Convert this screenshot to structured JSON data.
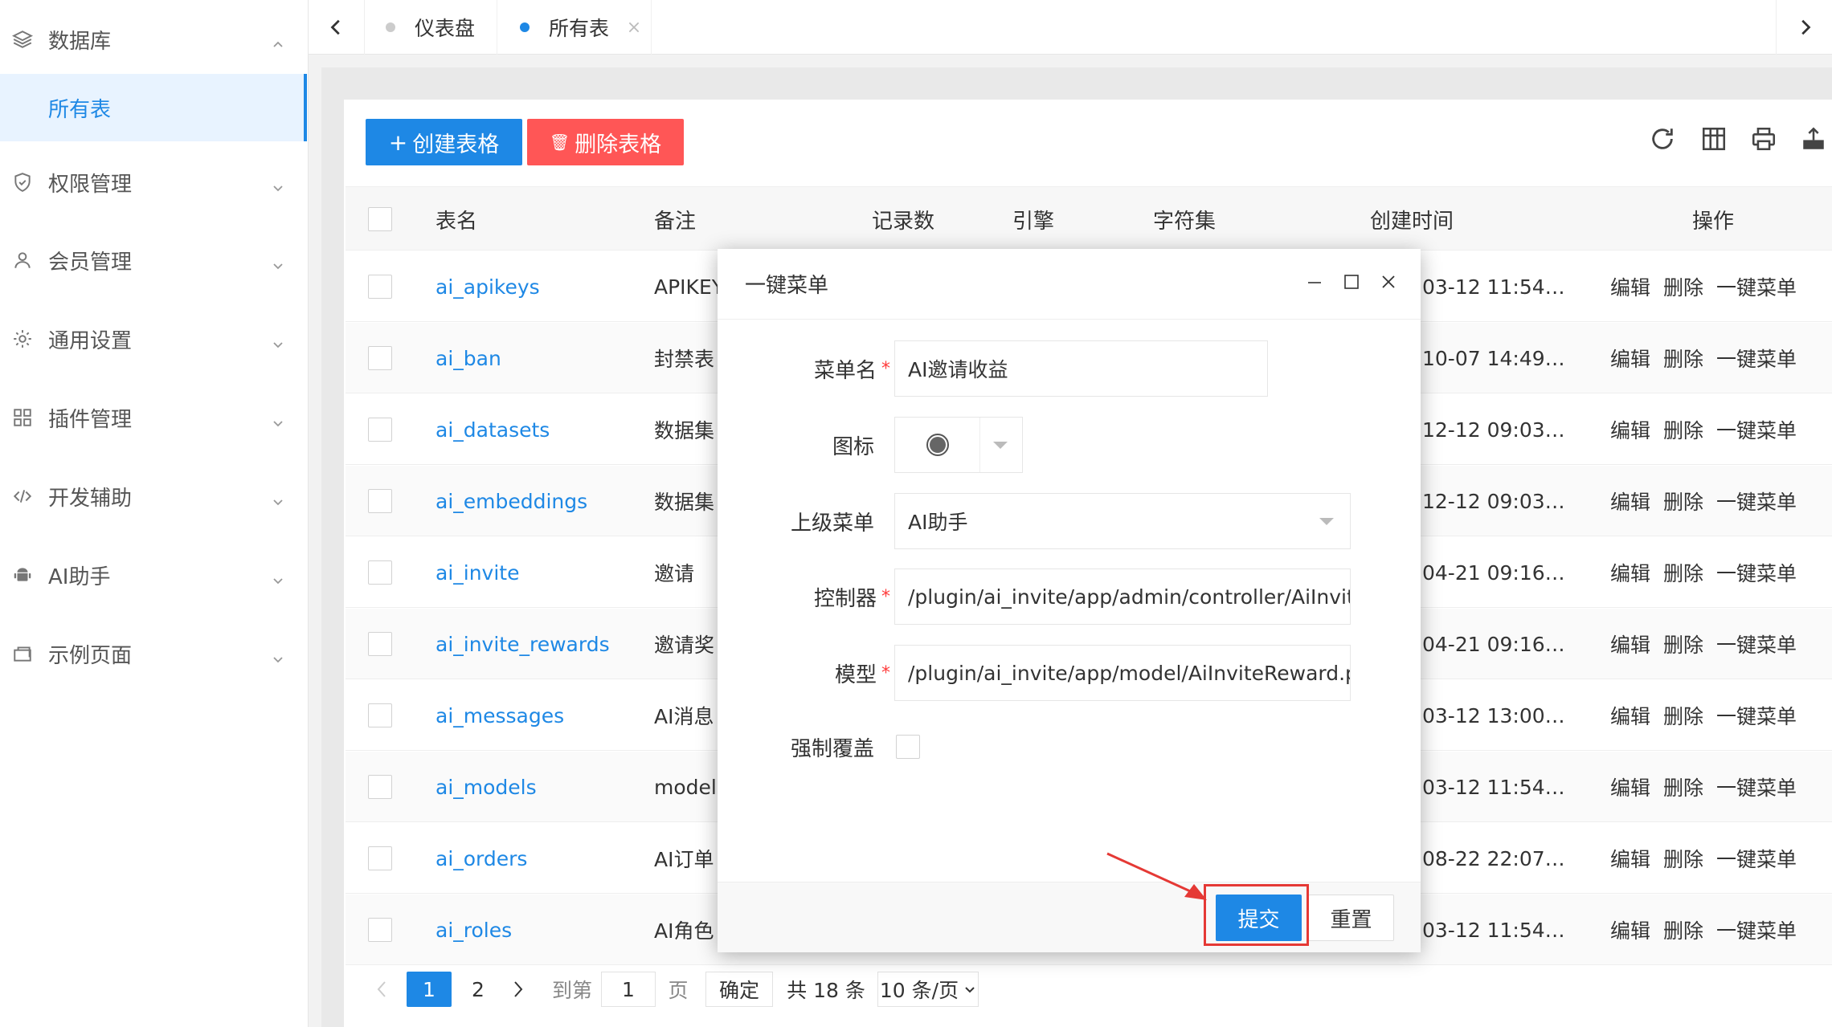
{
  "sidebar": {
    "groups": [
      {
        "label": "数据库",
        "icon": "layers-icon",
        "expanded": true
      },
      {
        "label": "权限管理",
        "icon": "shield-icon"
      },
      {
        "label": "会员管理",
        "icon": "user-icon"
      },
      {
        "label": "通用设置",
        "icon": "gear-icon"
      },
      {
        "label": "插件管理",
        "icon": "grid-icon"
      },
      {
        "label": "开发辅助",
        "icon": "code-icon"
      },
      {
        "label": "AI助手",
        "icon": "android-icon"
      },
      {
        "label": "示例页面",
        "icon": "template-icon"
      }
    ],
    "active_sub": "所有表"
  },
  "tabs": [
    {
      "label": "仪表盘",
      "active": false
    },
    {
      "label": "所有表",
      "active": true
    }
  ],
  "toolbar": {
    "create_label": "创建表格",
    "delete_label": "删除表格"
  },
  "table": {
    "headers": [
      "表名",
      "备注",
      "记录数",
      "引擎",
      "字符集",
      "创建时间",
      "操作"
    ],
    "rows": [
      {
        "name": "ai_apikeys",
        "remark": "APIKEY",
        "created": "03-12 11:54…"
      },
      {
        "name": "ai_ban",
        "remark": "封禁表",
        "created": "10-07 14:49…"
      },
      {
        "name": "ai_datasets",
        "remark": "数据集",
        "created": "12-12 09:03…"
      },
      {
        "name": "ai_embeddings",
        "remark": "数据集",
        "created": "12-12 09:03…"
      },
      {
        "name": "ai_invite",
        "remark": "邀请",
        "created": "04-21 09:16…"
      },
      {
        "name": "ai_invite_rewards",
        "remark": "邀请奖",
        "created": "04-21 09:16…"
      },
      {
        "name": "ai_messages",
        "remark": "AI消息",
        "created": "03-12 13:00…"
      },
      {
        "name": "ai_models",
        "remark": "models",
        "created": "03-12 11:54…"
      },
      {
        "name": "ai_orders",
        "remark": "AI订单",
        "created": "08-22 22:07…"
      },
      {
        "name": "ai_roles",
        "remark": "AI角色",
        "created": "03-12 11:54…"
      }
    ],
    "ops": [
      "编辑",
      "删除",
      "一键菜单"
    ]
  },
  "pager": {
    "pages": [
      "1",
      "2"
    ],
    "current": "1",
    "goto_label": "到第",
    "goto_value": "1",
    "page_unit": "页",
    "confirm_label": "确定",
    "total_label": "共 18 条",
    "page_size_label": "10 条/页"
  },
  "dialog": {
    "title": "一键菜单",
    "fields": {
      "menu_name_label": "菜单名",
      "menu_name_value": "AI邀请收益",
      "icon_label": "图标",
      "parent_label": "上级菜单",
      "parent_value": "AI助手",
      "controller_label": "控制器",
      "controller_value": "/plugin/ai_invite/app/admin/controller/AiInviteRewardController.php",
      "model_label": "模型",
      "model_value": "/plugin/ai_invite/app/model/AiInviteReward.php",
      "force_label": "强制覆盖"
    },
    "submit_label": "提交",
    "reset_label": "重置"
  },
  "colors": {
    "primary": "#1e88e5",
    "danger": "#ff5656",
    "annotation": "#e53935"
  }
}
